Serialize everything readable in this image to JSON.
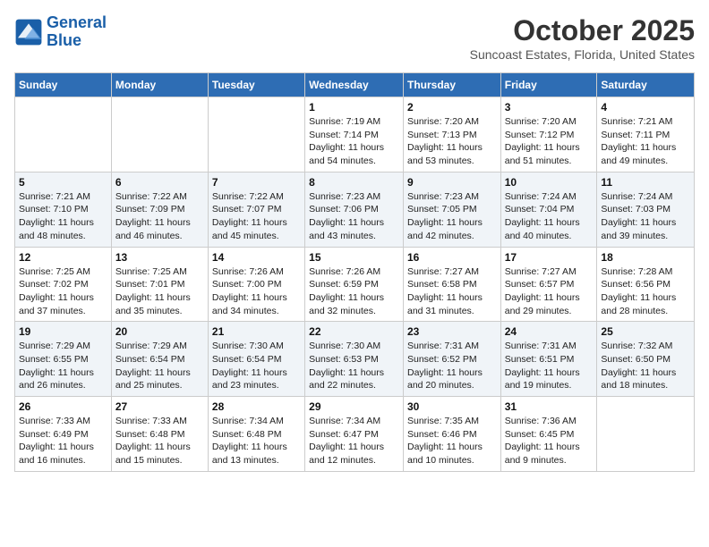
{
  "header": {
    "logo_line1": "General",
    "logo_line2": "Blue",
    "month": "October 2025",
    "location": "Suncoast Estates, Florida, United States"
  },
  "days_of_week": [
    "Sunday",
    "Monday",
    "Tuesday",
    "Wednesday",
    "Thursday",
    "Friday",
    "Saturday"
  ],
  "weeks": [
    [
      {
        "day": "",
        "content": ""
      },
      {
        "day": "",
        "content": ""
      },
      {
        "day": "",
        "content": ""
      },
      {
        "day": "1",
        "content": "Sunrise: 7:19 AM\nSunset: 7:14 PM\nDaylight: 11 hours\nand 54 minutes."
      },
      {
        "day": "2",
        "content": "Sunrise: 7:20 AM\nSunset: 7:13 PM\nDaylight: 11 hours\nand 53 minutes."
      },
      {
        "day": "3",
        "content": "Sunrise: 7:20 AM\nSunset: 7:12 PM\nDaylight: 11 hours\nand 51 minutes."
      },
      {
        "day": "4",
        "content": "Sunrise: 7:21 AM\nSunset: 7:11 PM\nDaylight: 11 hours\nand 49 minutes."
      }
    ],
    [
      {
        "day": "5",
        "content": "Sunrise: 7:21 AM\nSunset: 7:10 PM\nDaylight: 11 hours\nand 48 minutes."
      },
      {
        "day": "6",
        "content": "Sunrise: 7:22 AM\nSunset: 7:09 PM\nDaylight: 11 hours\nand 46 minutes."
      },
      {
        "day": "7",
        "content": "Sunrise: 7:22 AM\nSunset: 7:07 PM\nDaylight: 11 hours\nand 45 minutes."
      },
      {
        "day": "8",
        "content": "Sunrise: 7:23 AM\nSunset: 7:06 PM\nDaylight: 11 hours\nand 43 minutes."
      },
      {
        "day": "9",
        "content": "Sunrise: 7:23 AM\nSunset: 7:05 PM\nDaylight: 11 hours\nand 42 minutes."
      },
      {
        "day": "10",
        "content": "Sunrise: 7:24 AM\nSunset: 7:04 PM\nDaylight: 11 hours\nand 40 minutes."
      },
      {
        "day": "11",
        "content": "Sunrise: 7:24 AM\nSunset: 7:03 PM\nDaylight: 11 hours\nand 39 minutes."
      }
    ],
    [
      {
        "day": "12",
        "content": "Sunrise: 7:25 AM\nSunset: 7:02 PM\nDaylight: 11 hours\nand 37 minutes."
      },
      {
        "day": "13",
        "content": "Sunrise: 7:25 AM\nSunset: 7:01 PM\nDaylight: 11 hours\nand 35 minutes."
      },
      {
        "day": "14",
        "content": "Sunrise: 7:26 AM\nSunset: 7:00 PM\nDaylight: 11 hours\nand 34 minutes."
      },
      {
        "day": "15",
        "content": "Sunrise: 7:26 AM\nSunset: 6:59 PM\nDaylight: 11 hours\nand 32 minutes."
      },
      {
        "day": "16",
        "content": "Sunrise: 7:27 AM\nSunset: 6:58 PM\nDaylight: 11 hours\nand 31 minutes."
      },
      {
        "day": "17",
        "content": "Sunrise: 7:27 AM\nSunset: 6:57 PM\nDaylight: 11 hours\nand 29 minutes."
      },
      {
        "day": "18",
        "content": "Sunrise: 7:28 AM\nSunset: 6:56 PM\nDaylight: 11 hours\nand 28 minutes."
      }
    ],
    [
      {
        "day": "19",
        "content": "Sunrise: 7:29 AM\nSunset: 6:55 PM\nDaylight: 11 hours\nand 26 minutes."
      },
      {
        "day": "20",
        "content": "Sunrise: 7:29 AM\nSunset: 6:54 PM\nDaylight: 11 hours\nand 25 minutes."
      },
      {
        "day": "21",
        "content": "Sunrise: 7:30 AM\nSunset: 6:54 PM\nDaylight: 11 hours\nand 23 minutes."
      },
      {
        "day": "22",
        "content": "Sunrise: 7:30 AM\nSunset: 6:53 PM\nDaylight: 11 hours\nand 22 minutes."
      },
      {
        "day": "23",
        "content": "Sunrise: 7:31 AM\nSunset: 6:52 PM\nDaylight: 11 hours\nand 20 minutes."
      },
      {
        "day": "24",
        "content": "Sunrise: 7:31 AM\nSunset: 6:51 PM\nDaylight: 11 hours\nand 19 minutes."
      },
      {
        "day": "25",
        "content": "Sunrise: 7:32 AM\nSunset: 6:50 PM\nDaylight: 11 hours\nand 18 minutes."
      }
    ],
    [
      {
        "day": "26",
        "content": "Sunrise: 7:33 AM\nSunset: 6:49 PM\nDaylight: 11 hours\nand 16 minutes."
      },
      {
        "day": "27",
        "content": "Sunrise: 7:33 AM\nSunset: 6:48 PM\nDaylight: 11 hours\nand 15 minutes."
      },
      {
        "day": "28",
        "content": "Sunrise: 7:34 AM\nSunset: 6:48 PM\nDaylight: 11 hours\nand 13 minutes."
      },
      {
        "day": "29",
        "content": "Sunrise: 7:34 AM\nSunset: 6:47 PM\nDaylight: 11 hours\nand 12 minutes."
      },
      {
        "day": "30",
        "content": "Sunrise: 7:35 AM\nSunset: 6:46 PM\nDaylight: 11 hours\nand 10 minutes."
      },
      {
        "day": "31",
        "content": "Sunrise: 7:36 AM\nSunset: 6:45 PM\nDaylight: 11 hours\nand 9 minutes."
      },
      {
        "day": "",
        "content": ""
      }
    ]
  ]
}
